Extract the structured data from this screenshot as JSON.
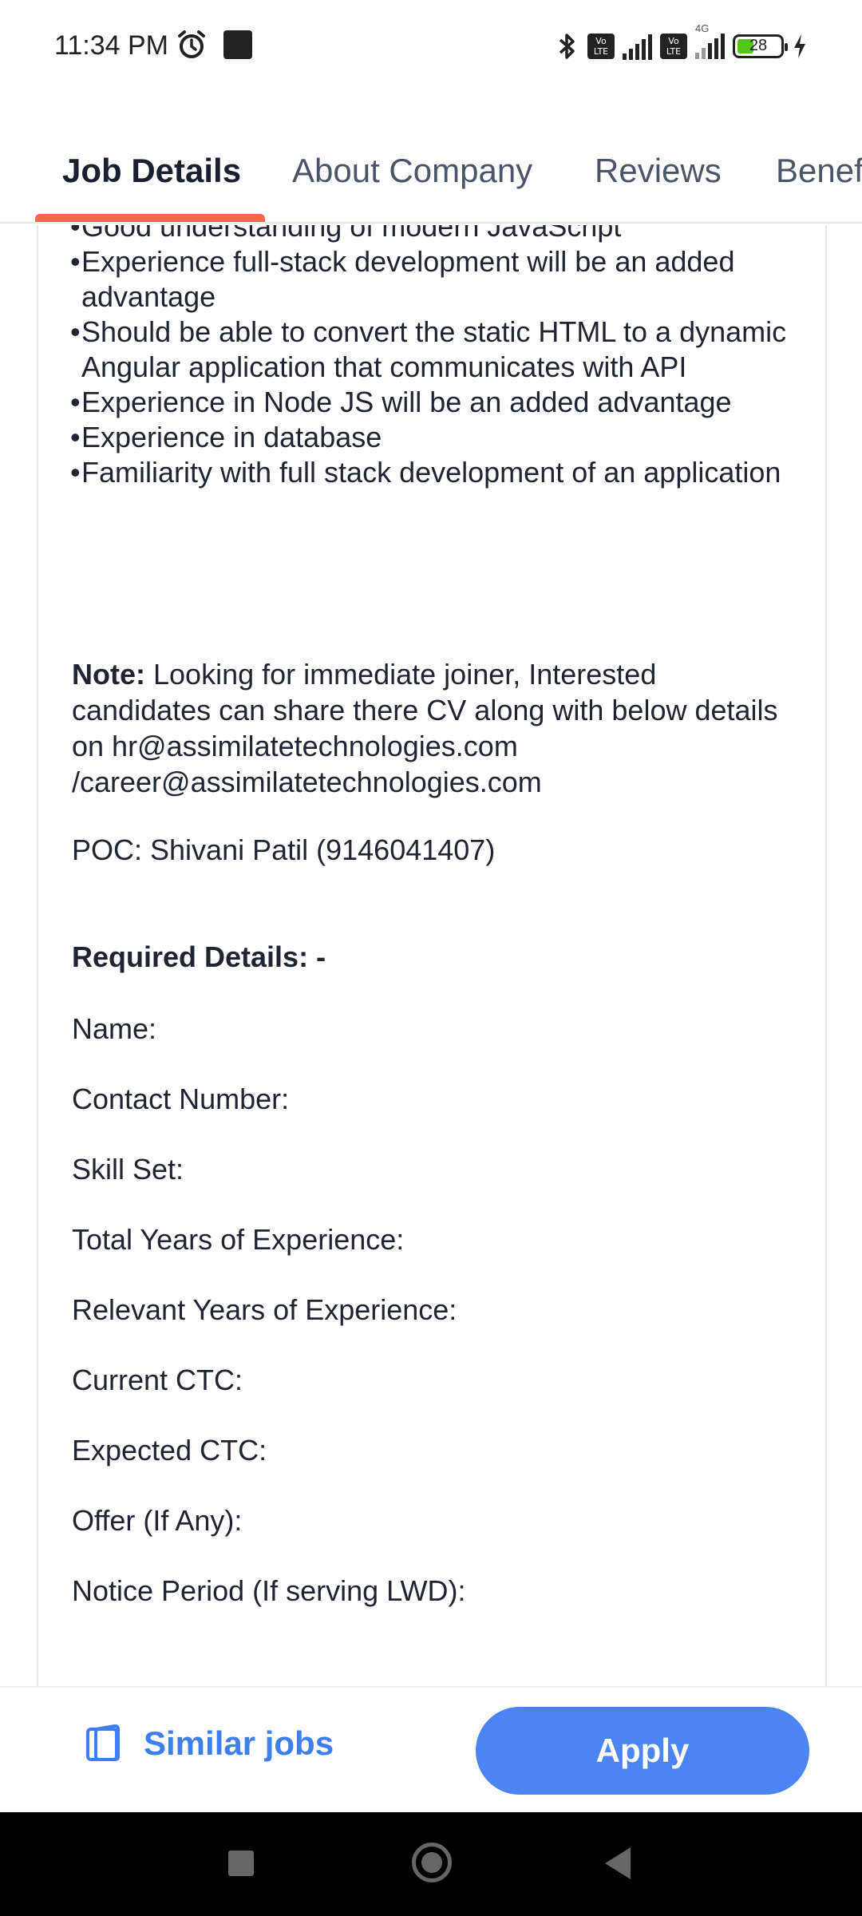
{
  "status_bar": {
    "time": "11:34 PM",
    "battery_level": "28",
    "network_label": "4G",
    "volte_label": "Vo LTE",
    "icons": [
      "alarm-icon",
      "notification-square-icon",
      "bluetooth-icon",
      "volte-icon",
      "signal-icon",
      "battery-icon",
      "charging-icon"
    ]
  },
  "tabs": [
    {
      "label": "Job Details",
      "active": true
    },
    {
      "label": "About Company",
      "active": false
    },
    {
      "label": "Reviews",
      "active": false
    },
    {
      "label": "Benef",
      "active": false
    }
  ],
  "colors": {
    "accent_underline": "#f2694f",
    "primary_blue": "#4a84f5",
    "link_blue": "#3d7ef0"
  },
  "description": {
    "bullets": [
      "Good understanding of modern JavaScript",
      "Experience full-stack development will be an added advantage",
      "Should be able to convert the static HTML to a dynamic Angular application that communicates with API",
      "Experience in Node JS will be an added advantage",
      "Experience in database",
      "Familiarity with full stack development of an application"
    ],
    "note_label": "Note:",
    "note_text": " Looking for immediate joiner, Interested candidates can share there CV along with below details on hr@assimilatetechnologies.com /career@assimilatetechnologies.com",
    "poc": "POC: Shivani Patil (9146041407)",
    "required_title": "Required Details: -",
    "fields": [
      "Name:",
      "Contact Number:",
      "Skill Set:",
      "Total Years of Experience:",
      "Relevant Years of Experience:",
      "Current CTC:",
      "Expected CTC:",
      "Offer (If Any):",
      "Notice Period (If serving LWD):"
    ]
  },
  "actions": {
    "similar_jobs_label": "Similar jobs",
    "apply_label": "Apply"
  }
}
